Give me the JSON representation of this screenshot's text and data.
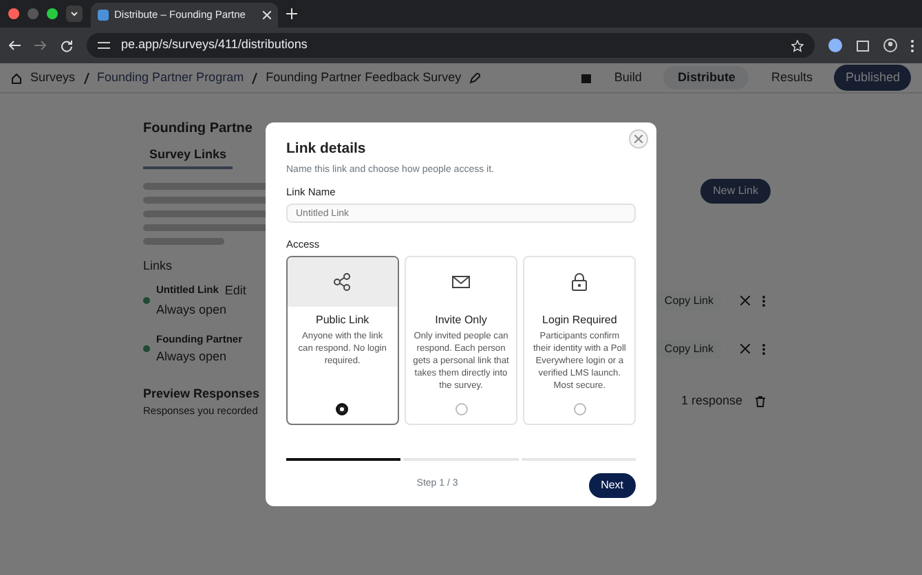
{
  "browser": {
    "tab_title": "Distribute – Founding Partne",
    "url": "pe.app/s/surveys/411/distributions"
  },
  "page": {
    "breadcrumb": [
      "Surveys",
      "Founding Partner Program",
      "Founding Partner Feedback Survey"
    ],
    "nav": [
      {
        "label": "Build",
        "selected": false
      },
      {
        "label": "Distribute",
        "selected": true
      },
      {
        "label": "Results",
        "selected": false
      }
    ],
    "publish_button": "Published",
    "title": "Founding Partne",
    "tabs": [
      {
        "label": "Survey Links",
        "selected": true
      }
    ],
    "new_link_button": "New Link",
    "links_heading": "Links",
    "links": [
      {
        "name": "Untitled Link",
        "edit": "Edit",
        "status": "Always open",
        "copy": "Copy Link"
      },
      {
        "name": "Founding Partner",
        "status": "Always open",
        "copy": "Copy Link"
      }
    ],
    "preview": {
      "title": "Preview Responses",
      "subtitle": "Responses you recorded",
      "count": "1 response"
    }
  },
  "modal": {
    "title": "Link details",
    "subtitle": "Name this link and choose how people access it.",
    "name_label": "Link Name",
    "name_placeholder": "Untitled Link",
    "access_label": "Access",
    "options": [
      {
        "kind": "share",
        "title": "Public Link",
        "description": "Anyone with the link can respond. No login required.",
        "selected": true
      },
      {
        "kind": "mail",
        "title": "Invite Only",
        "description": "Only invited people can respond. Each person gets a personal link that takes them directly into the survey.",
        "selected": false
      },
      {
        "kind": "lock",
        "title": "Login Required",
        "description": "Participants confirm their identity with a Poll Everywhere login or a verified LMS launch. Most secure.",
        "selected": false
      }
    ],
    "steps": [
      {
        "selected": true
      },
      {
        "selected": false
      },
      {
        "selected": false
      }
    ],
    "step_label": "Step 1 / 3",
    "next_button": "Next"
  }
}
